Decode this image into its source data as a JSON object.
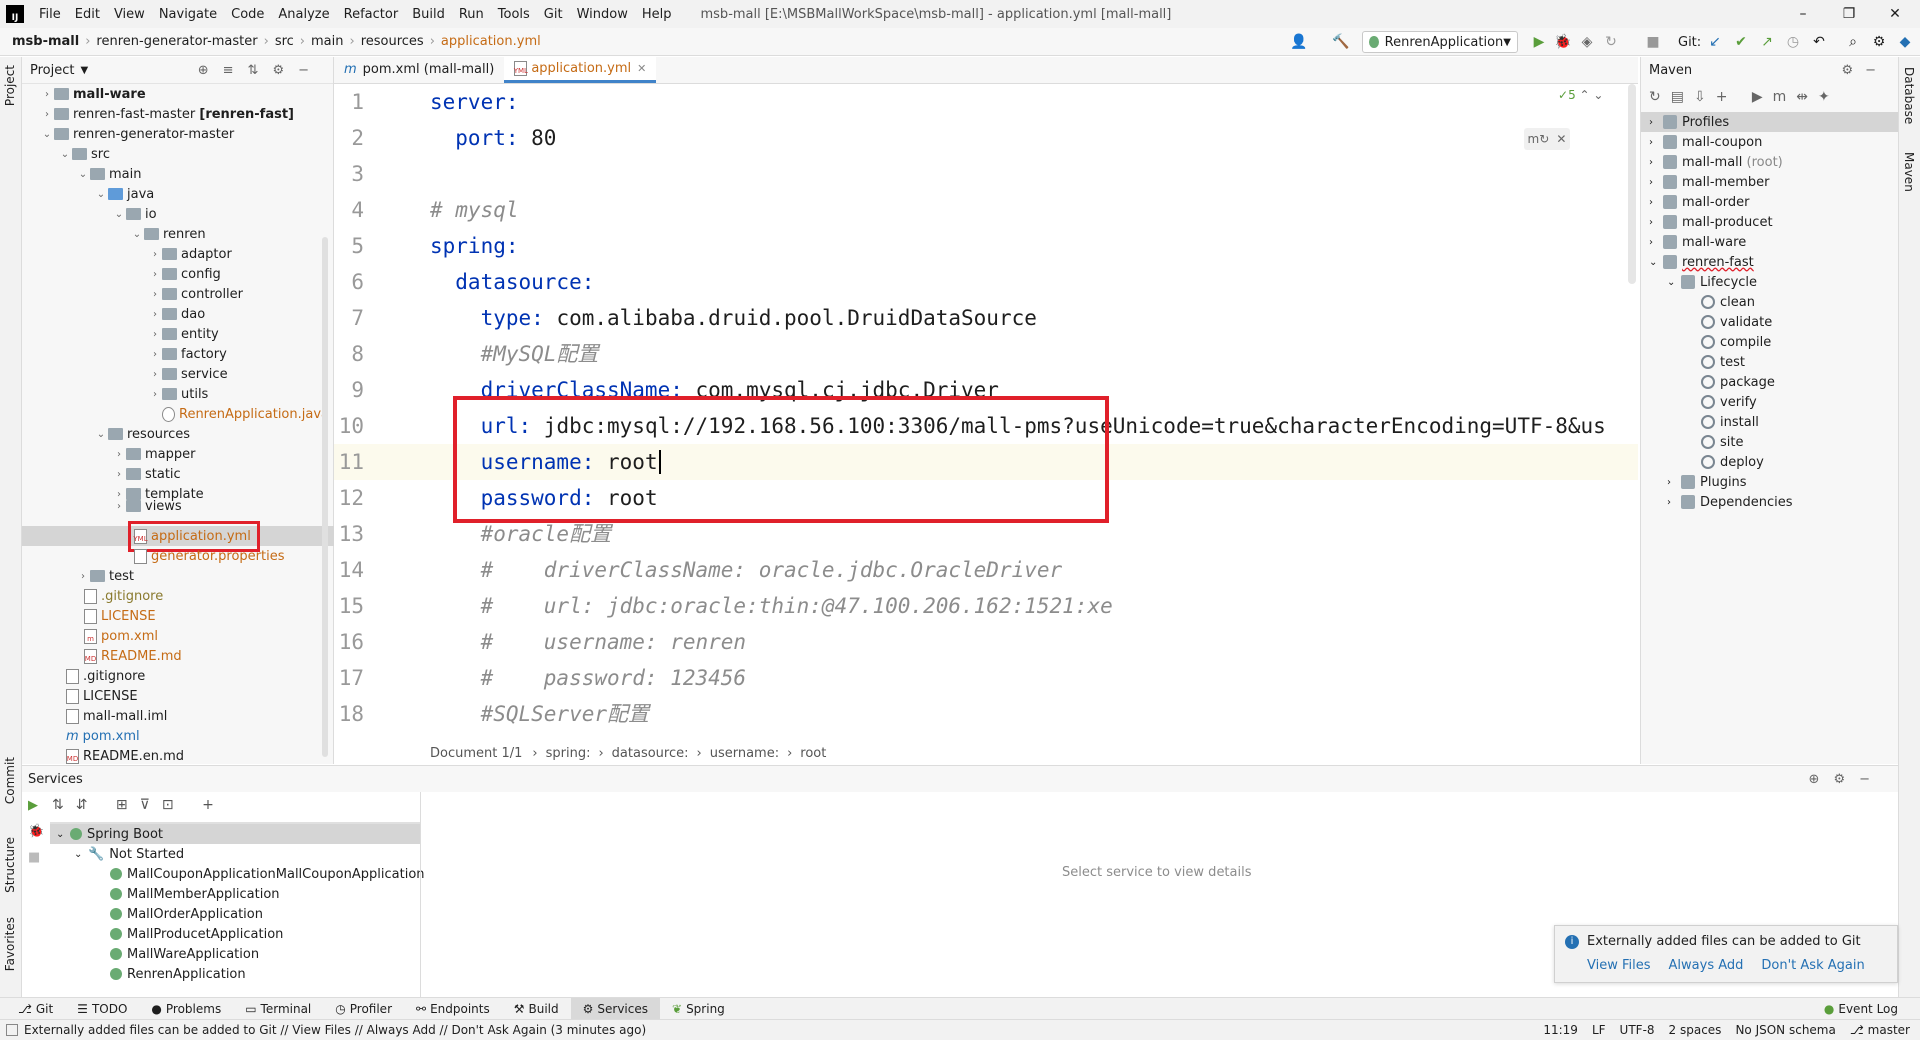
{
  "menubar": {
    "items": [
      "File",
      "Edit",
      "View",
      "Navigate",
      "Code",
      "Analyze",
      "Refactor",
      "Build",
      "Run",
      "Tools",
      "Git",
      "Window",
      "Help"
    ],
    "title": "msb-mall [E:\\MSBMallWorkSpace\\msb-mall] - application.yml [mall-mall]"
  },
  "navbar": {
    "crumbs": [
      "msb-mall",
      "renren-generator-master",
      "src",
      "main",
      "resources",
      "application.yml"
    ],
    "run_config": "RenrenApplication",
    "git_label": "Git:"
  },
  "left_stripe": {
    "project": "Project",
    "commit": "Commit",
    "structure": "Structure",
    "favorites": "Favorites"
  },
  "right_stripe": {
    "database": "Database",
    "maven": "Maven"
  },
  "project": {
    "header": "Project",
    "tree": [
      {
        "label": "mall-ware",
        "bold": true
      },
      {
        "label": "renren-fast-master",
        "suffix": "[renren-fast]"
      },
      {
        "label": "renren-generator-master"
      },
      {
        "label": "src"
      },
      {
        "label": "main"
      },
      {
        "label": "java"
      },
      {
        "label": "io"
      },
      {
        "label": "renren"
      },
      {
        "label": "adaptor"
      },
      {
        "label": "config"
      },
      {
        "label": "controller"
      },
      {
        "label": "dao"
      },
      {
        "label": "entity"
      },
      {
        "label": "factory"
      },
      {
        "label": "service"
      },
      {
        "label": "utils"
      },
      {
        "label": "RenrenApplication.java"
      },
      {
        "label": "resources"
      },
      {
        "label": "mapper"
      },
      {
        "label": "static"
      },
      {
        "label": "template"
      },
      {
        "label": "views"
      },
      {
        "label": "application.yml"
      },
      {
        "label": "generator.properties"
      },
      {
        "label": "test"
      },
      {
        "label": ".gitignore"
      },
      {
        "label": "LICENSE"
      },
      {
        "label": "pom.xml"
      },
      {
        "label": "README.md"
      },
      {
        "label": ".gitignore"
      },
      {
        "label": "LICENSE"
      },
      {
        "label": "mall-mall.iml"
      },
      {
        "label": "pom.xml"
      },
      {
        "label": "README.en.md"
      }
    ]
  },
  "editor": {
    "tabs": [
      "pom.xml (mall-mall)",
      "application.yml"
    ],
    "inspection_count": "5",
    "lines": [
      {
        "n": "1",
        "key": "server:",
        "rest": ""
      },
      {
        "n": "2",
        "key": "  port:",
        "rest": " 80"
      },
      {
        "n": "3",
        "key": "",
        "rest": ""
      },
      {
        "n": "4",
        "comment": "# mysql"
      },
      {
        "n": "5",
        "key": "spring:",
        "rest": ""
      },
      {
        "n": "6",
        "key": "  datasource:",
        "rest": ""
      },
      {
        "n": "7",
        "key": "    type:",
        "rest": " com.alibaba.druid.pool.DruidDataSource"
      },
      {
        "n": "8",
        "comment": "    #MySQL配置"
      },
      {
        "n": "9",
        "key": "    driverClassName:",
        "rest": " com.mysql.cj.jdbc.Driver"
      },
      {
        "n": "10",
        "key": "    url:",
        "rest": " jdbc:mysql://192.168.56.100:3306/mall-pms?useUnicode=true&characterEncoding=UTF-8&us"
      },
      {
        "n": "11",
        "key": "    username:",
        "rest": " root"
      },
      {
        "n": "12",
        "key": "    password:",
        "rest": " root"
      },
      {
        "n": "13",
        "comment": "    #oracle配置"
      },
      {
        "n": "14",
        "comment": "    #    driverClassName: oracle.jdbc.OracleDriver"
      },
      {
        "n": "15",
        "comment": "    #    url: jdbc:oracle:thin:@47.100.206.162:1521:xe"
      },
      {
        "n": "16",
        "comment": "    #    username: renren"
      },
      {
        "n": "17",
        "comment": "    #    password: 123456"
      },
      {
        "n": "18",
        "comment": "    #SQLServer配置"
      }
    ],
    "breadcrumb": [
      "Document 1/1",
      "spring:",
      "datasource:",
      "username:",
      "root"
    ]
  },
  "maven": {
    "header": "Maven",
    "items": [
      {
        "label": "Profiles"
      },
      {
        "label": "mall-coupon"
      },
      {
        "label": "mall-mall",
        "suffix": "(root)"
      },
      {
        "label": "mall-member"
      },
      {
        "label": "mall-order"
      },
      {
        "label": "mall-producet"
      },
      {
        "label": "mall-ware"
      },
      {
        "label": "renren-fast"
      },
      {
        "label": "Lifecycle"
      },
      {
        "label": "clean"
      },
      {
        "label": "validate"
      },
      {
        "label": "compile"
      },
      {
        "label": "test"
      },
      {
        "label": "package"
      },
      {
        "label": "verify"
      },
      {
        "label": "install"
      },
      {
        "label": "site"
      },
      {
        "label": "deploy"
      },
      {
        "label": "Plugins"
      },
      {
        "label": "Dependencies"
      }
    ]
  },
  "services": {
    "header": "Services",
    "tree": [
      "Spring Boot",
      "Not Started",
      "MallCouponApplicationMallCouponApplication",
      "MallMemberApplication",
      "MallOrderApplication",
      "MallProducetApplication",
      "MallWareApplication",
      "RenrenApplication"
    ],
    "placeholder": "Select service to view details"
  },
  "notification": {
    "text": "Externally added files can be added to Git",
    "actions": [
      "View Files",
      "Always Add",
      "Don't Ask Again"
    ]
  },
  "bottom_tools": [
    "Git",
    "TODO",
    "Problems",
    "Terminal",
    "Profiler",
    "Endpoints",
    "Build",
    "Services",
    "Spring"
  ],
  "event_log": "Event Log",
  "status": {
    "message": "Externally added files can be added to Git // View Files // Always Add // Don't Ask Again (3 minutes ago)",
    "position": "11:19",
    "line_sep": "LF",
    "encoding": "UTF-8",
    "indent": "2 spaces",
    "schema": "No JSON schema",
    "vcs": "master"
  },
  "colors": {
    "keyword": "#0033b3",
    "comment": "#8c8c8c",
    "highlight_box": "#e0202a",
    "active_tab": "#4083c9",
    "selection": "#d5d5d5"
  }
}
